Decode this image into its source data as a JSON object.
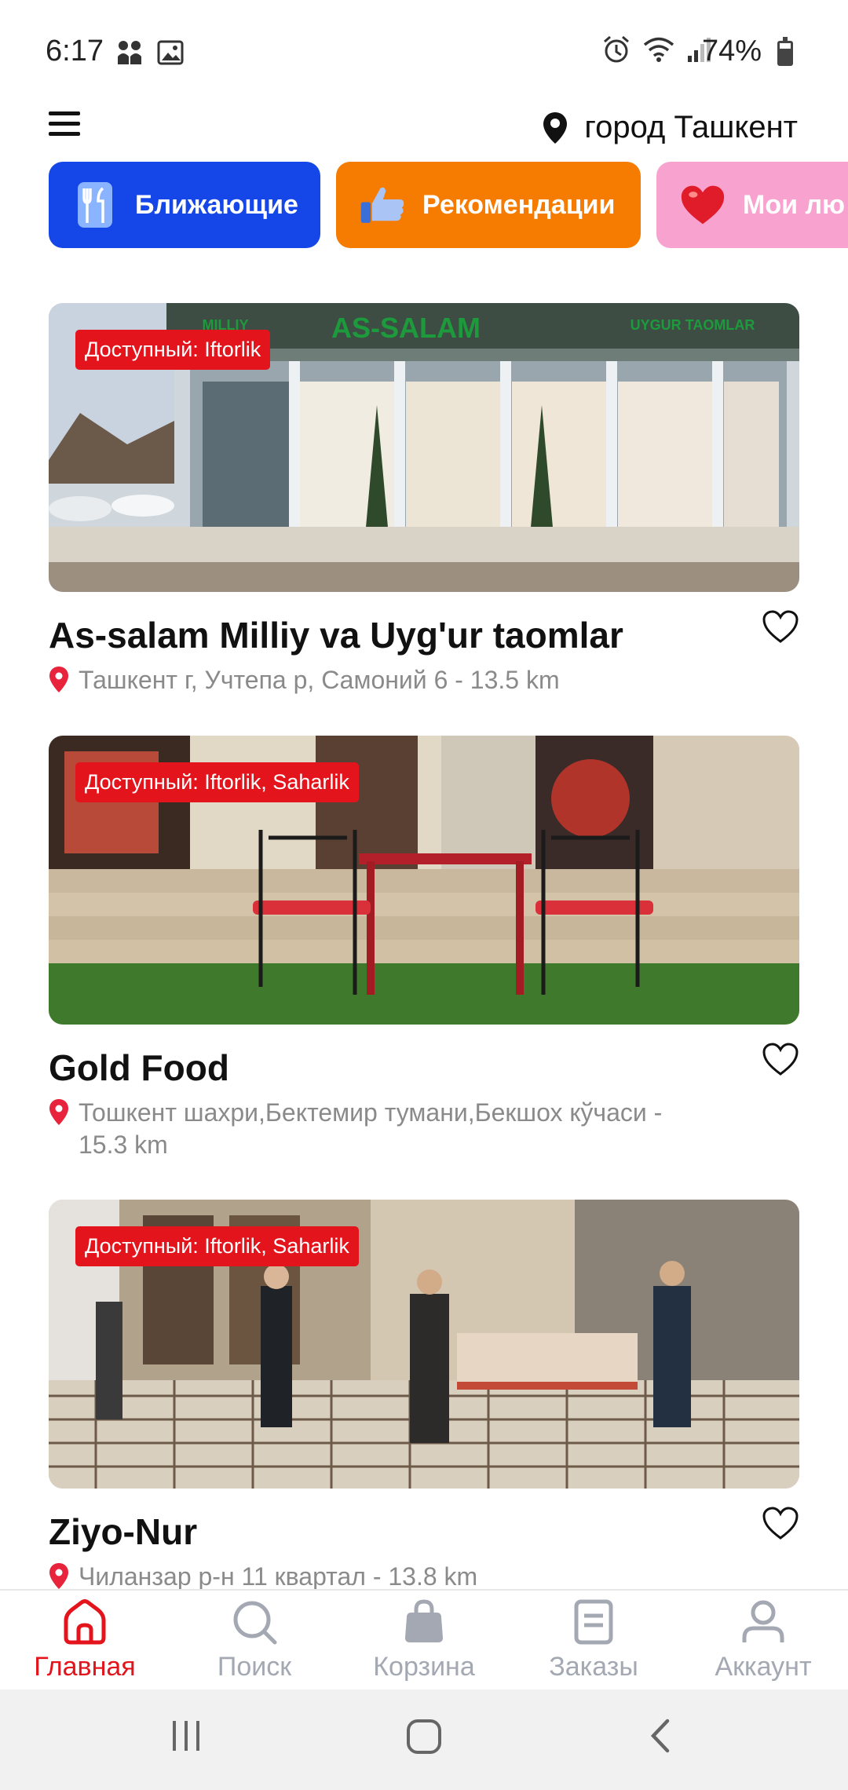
{
  "status": {
    "time": "6:17",
    "battery": "74%"
  },
  "header": {
    "location": "город Ташкент"
  },
  "categories": [
    {
      "label": "Ближающие"
    },
    {
      "label": "Рекомендации"
    },
    {
      "label": "Мои лю"
    }
  ],
  "restaurants": [
    {
      "badge": "Доступный: Iftorlik",
      "name": "As-salam Milliy va Uyg'ur taomlar",
      "address": "Ташкент г, Учтепа р, Самоний 6 - 13.5 km",
      "sign_text": "AS-SALAM",
      "sign_left": "MILLIY",
      "sign_right": "UYGUR TAOMLAR"
    },
    {
      "badge": "Доступный: Iftorlik, Saharlik",
      "name": "Gold Food",
      "address": "Тошкент шахри,Бектемир тумани,Бекшох кўчаси - 15.3 km"
    },
    {
      "badge": "Доступный: Iftorlik, Saharlik",
      "name": "Ziyo-Nur",
      "address": "Чиланзар р-н 11 квартал - 13.8 km"
    }
  ],
  "tabs": [
    {
      "label": "Главная",
      "icon": "home-icon"
    },
    {
      "label": "Поиск",
      "icon": "search-icon"
    },
    {
      "label": "Корзина",
      "icon": "bag-icon"
    },
    {
      "label": "Заказы",
      "icon": "orders-icon"
    },
    {
      "label": "Аккаунт",
      "icon": "account-icon"
    }
  ],
  "colors": {
    "accent": "#e3141c",
    "blue_chip": "#1446e8",
    "orange_chip": "#f57c00",
    "pink_chip": "#f8a3cf",
    "inactive_tab": "#a3a8b2"
  }
}
